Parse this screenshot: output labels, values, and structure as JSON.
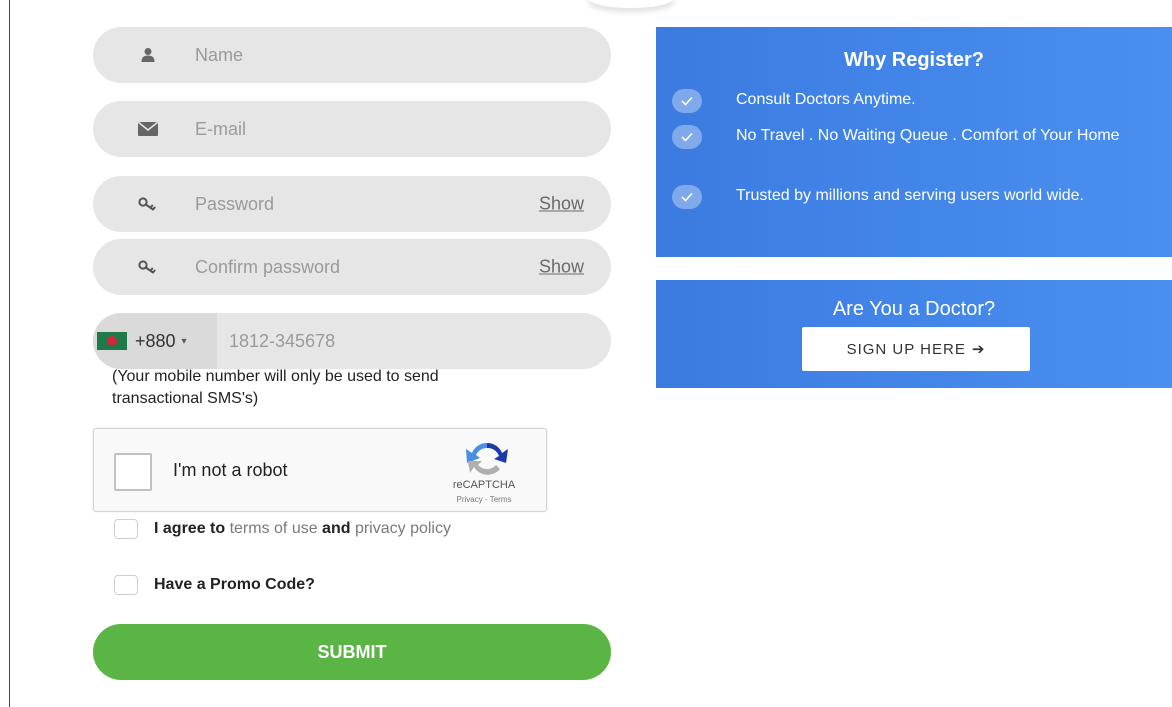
{
  "form": {
    "name": {
      "placeholder": "Name",
      "icon": "user-icon"
    },
    "email": {
      "placeholder": "E-mail",
      "icon": "envelope-icon"
    },
    "password": {
      "placeholder": "Password",
      "show_label": "Show",
      "icon": "key-icon"
    },
    "confirm_password": {
      "placeholder": "Confirm password",
      "show_label": "Show",
      "icon": "key-icon"
    },
    "phone": {
      "country_flag": "bangladesh-flag-icon",
      "dial_code": "+880",
      "caret": "▾",
      "placeholder": "1812-345678",
      "note": "(Your mobile number will only be used to send transactional SMS's)"
    },
    "captcha": {
      "label": "I'm not a robot",
      "brand": "reCAPTCHA",
      "links": "Privacy - Terms"
    },
    "agree": {
      "prefix": "I agree to ",
      "terms_link": "terms of use",
      "and": " and ",
      "privacy_link": "privacy policy"
    },
    "promo": {
      "label": "Have a Promo Code?"
    },
    "submit_label": "SUBMIT"
  },
  "why_register": {
    "title": "Why Register?",
    "items": [
      {
        "text": "Consult Doctors Anytime."
      },
      {
        "text": "No Travel . No Waiting Queue . Comfort of Your Home"
      },
      {
        "text": "Trusted by millions and serving users world wide."
      }
    ]
  },
  "doctor": {
    "title": "Are You a Doctor?",
    "signup_label": "SIGN UP HERE",
    "arrow": "➔"
  },
  "colors": {
    "field_bg": "#e6e6e6",
    "submit_green": "#5ab545",
    "panel_blue": "#3b7be0",
    "panel_blue_light": "#4a8ff0"
  }
}
